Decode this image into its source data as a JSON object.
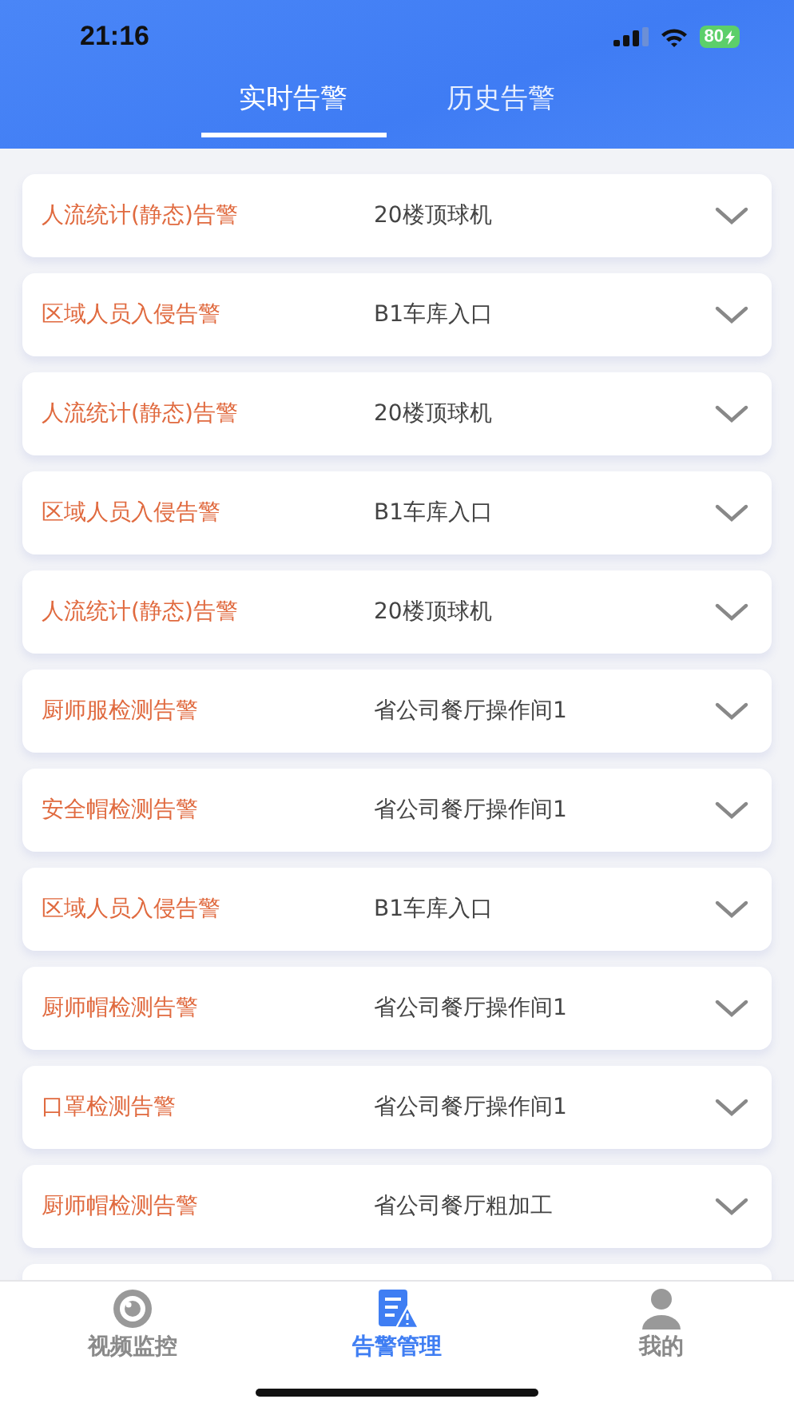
{
  "status_bar": {
    "time": "21:16",
    "battery": "80"
  },
  "tabs": [
    {
      "label": "实时告警",
      "selected": true
    },
    {
      "label": "历史告警",
      "selected": false
    }
  ],
  "alerts": [
    {
      "type": "人流统计(静态)告警",
      "location": "20楼顶球机",
      "expanded": false
    },
    {
      "type": "区域人员入侵告警",
      "location": "B1车库入口",
      "expanded": false
    },
    {
      "type": "人流统计(静态)告警",
      "location": "20楼顶球机",
      "expanded": false
    },
    {
      "type": "区域人员入侵告警",
      "location": "B1车库入口",
      "expanded": false
    },
    {
      "type": "人流统计(静态)告警",
      "location": "20楼顶球机",
      "expanded": false
    },
    {
      "type": "厨师服检测告警",
      "location": "省公司餐厅操作间1",
      "expanded": false
    },
    {
      "type": "安全帽检测告警",
      "location": "省公司餐厅操作间1",
      "expanded": false
    },
    {
      "type": "区域人员入侵告警",
      "location": "B1车库入口",
      "expanded": false
    },
    {
      "type": "厨师帽检测告警",
      "location": "省公司餐厅操作间1",
      "expanded": false
    },
    {
      "type": "口罩检测告警",
      "location": "省公司餐厅操作间1",
      "expanded": false
    },
    {
      "type": "厨师帽检测告警",
      "location": "省公司餐厅粗加工",
      "expanded": false
    }
  ],
  "bottom_nav": [
    {
      "kind": "camera",
      "label": "视频监控",
      "selected": false
    },
    {
      "kind": "alert",
      "label": "告警管理",
      "selected": true
    },
    {
      "kind": "profile",
      "label": "我的",
      "selected": false
    }
  ]
}
